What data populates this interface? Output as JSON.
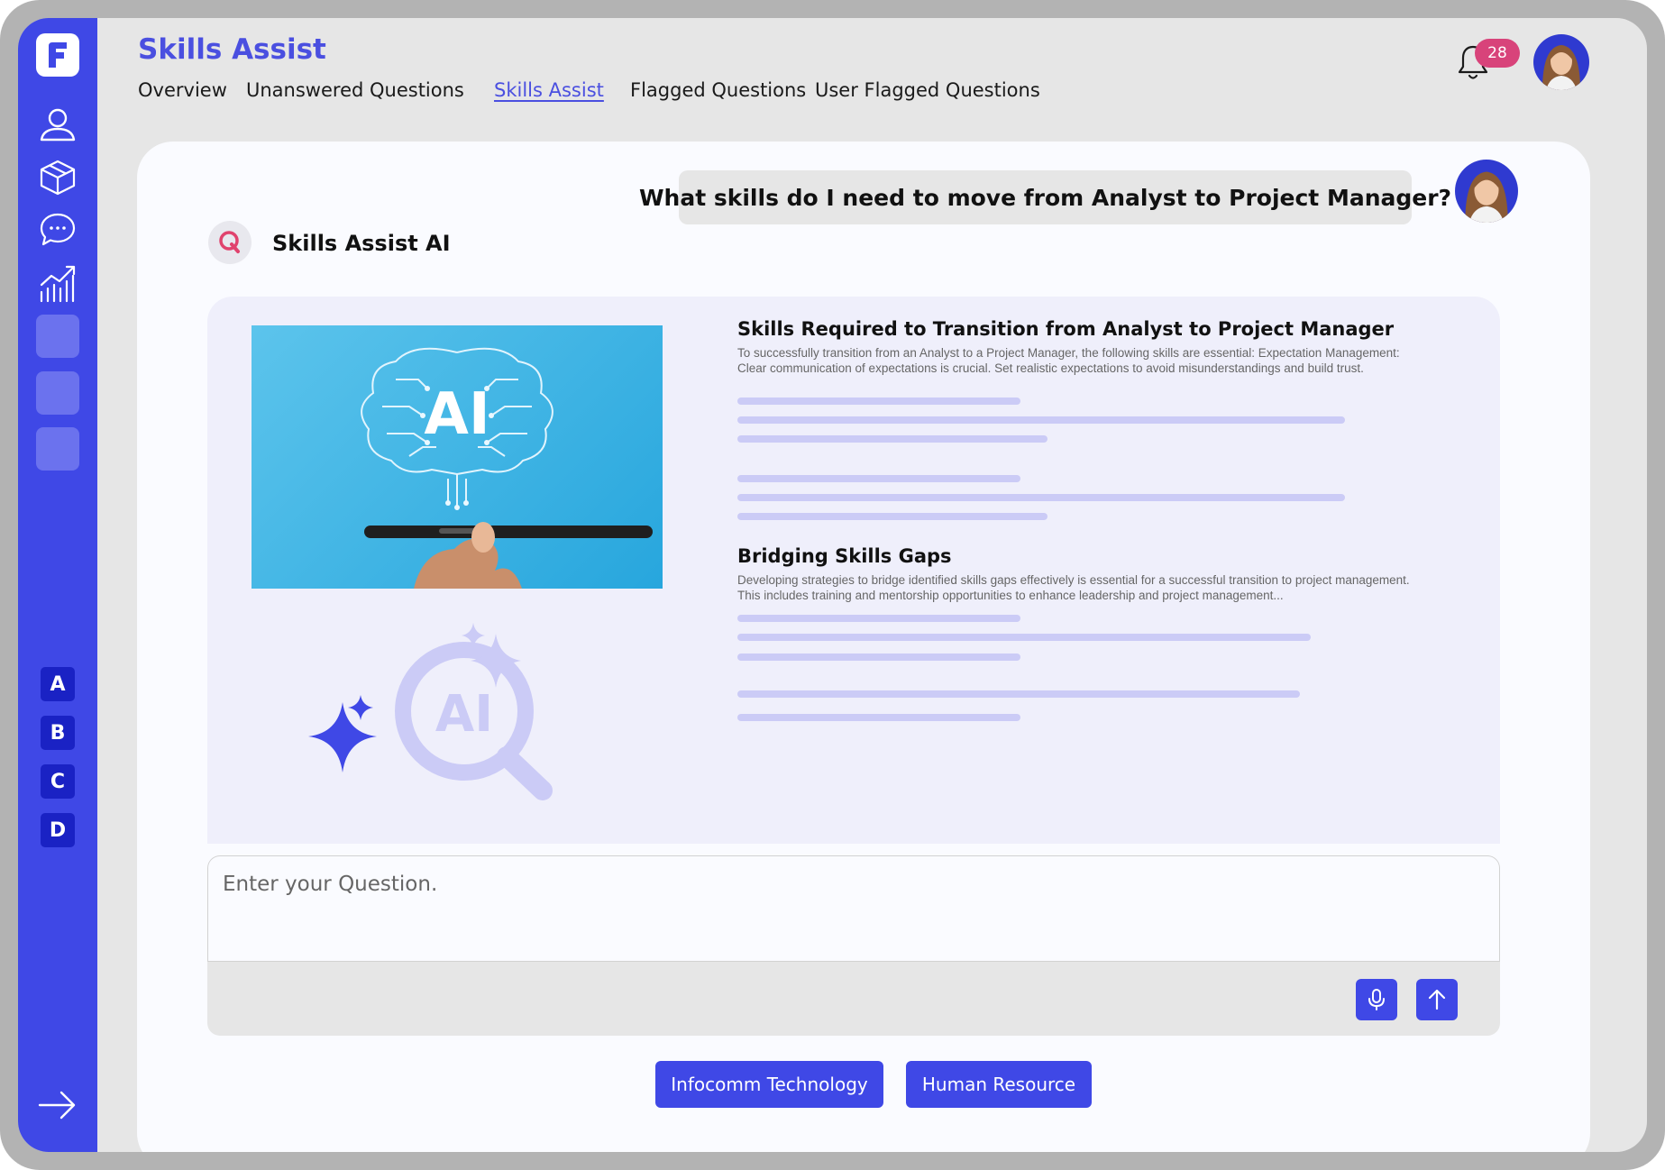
{
  "app": {
    "title": "Skills Assist"
  },
  "tabs": [
    {
      "label": "Overview"
    },
    {
      "label": "Unanswered Questions"
    },
    {
      "label": "Skills Assist",
      "active": true
    },
    {
      "label": "Flagged Questions"
    },
    {
      "label": "User Flagged Questions"
    }
  ],
  "notifications": {
    "count": "28",
    "icon": "bell-icon"
  },
  "sidebar": {
    "icons": [
      "user-icon",
      "box-icon",
      "chat-icon",
      "analytics-icon"
    ],
    "letters": [
      "A",
      "B",
      "C",
      "D"
    ],
    "expand_icon": "arrow-right-icon"
  },
  "chat": {
    "user_question": "What skills do I need to move from Analyst to Project Manager?",
    "assistant_name": "Skills Assist AI",
    "image_text": "AI",
    "sections": [
      {
        "title": "Skills Required to Transition from Analyst to Project Manager",
        "body": "To successfully transition from an Analyst to a Project Manager, the following skills are essential: Expectation Management: Clear communication of expectations is crucial. Set realistic expectations to avoid misunderstandings and build trust."
      },
      {
        "title": "Bridging Skills Gaps",
        "body": "Developing strategies to bridge identified skills gaps effectively is essential for a successful transition to project management. This includes training and mentorship opportunities to enhance leadership and project management..."
      }
    ]
  },
  "input": {
    "placeholder": "Enter your Question.",
    "mic_icon": "microphone-icon",
    "send_icon": "send-arrow-icon"
  },
  "suggestions": [
    {
      "label": "Infocomm Technology"
    },
    {
      "label": "Human Resource"
    }
  ],
  "colors": {
    "primary": "#3f48e6",
    "badge": "#d8437a",
    "answer_bg": "#efeffb",
    "placeholder_bar": "#cbcbf6"
  }
}
